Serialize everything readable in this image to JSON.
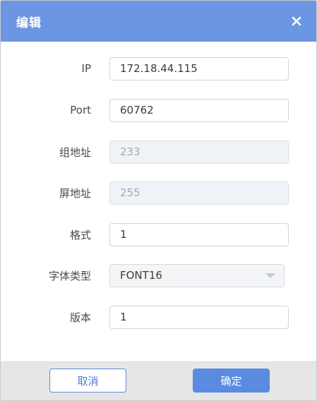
{
  "dialog": {
    "title": "编辑",
    "colors": {
      "header": "#6b96e3",
      "primary": "#5b8be0"
    }
  },
  "form": {
    "ip": {
      "label": "IP",
      "value": "172.18.44.115"
    },
    "port": {
      "label": "Port",
      "value": "60762"
    },
    "group_address": {
      "label": "组地址",
      "value": "233",
      "disabled": true
    },
    "screen_address": {
      "label": "屏地址",
      "value": "255",
      "disabled": true
    },
    "format": {
      "label": "格式",
      "value": "1"
    },
    "font_type": {
      "label": "字体类型",
      "selected": "FONT16"
    },
    "version": {
      "label": "版本",
      "value": "1"
    }
  },
  "footer": {
    "cancel_label": "取消",
    "confirm_label": "确定"
  },
  "icons": {
    "close": "close-icon",
    "dropdown": "chevron-down-icon"
  }
}
